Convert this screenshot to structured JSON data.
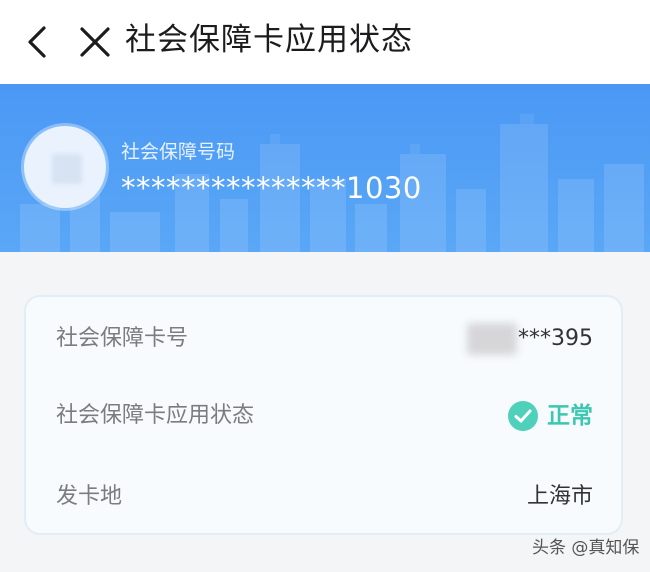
{
  "header": {
    "title": "社会保障卡应用状态",
    "back_icon": "chevron-left-icon",
    "close_icon": "close-icon"
  },
  "banner": {
    "label": "社会保障号码",
    "number": "***************1030",
    "background_color": "#4a98f4"
  },
  "card": {
    "rows": [
      {
        "label": "社会保障卡号",
        "value": "***395"
      },
      {
        "label": "社会保障卡应用状态",
        "value": "正常",
        "status_icon": "check-circle-icon",
        "status_color": "#3cc7b0"
      },
      {
        "label": "发卡地",
        "value": "上海市"
      }
    ]
  },
  "watermark": "头条 @真知保"
}
